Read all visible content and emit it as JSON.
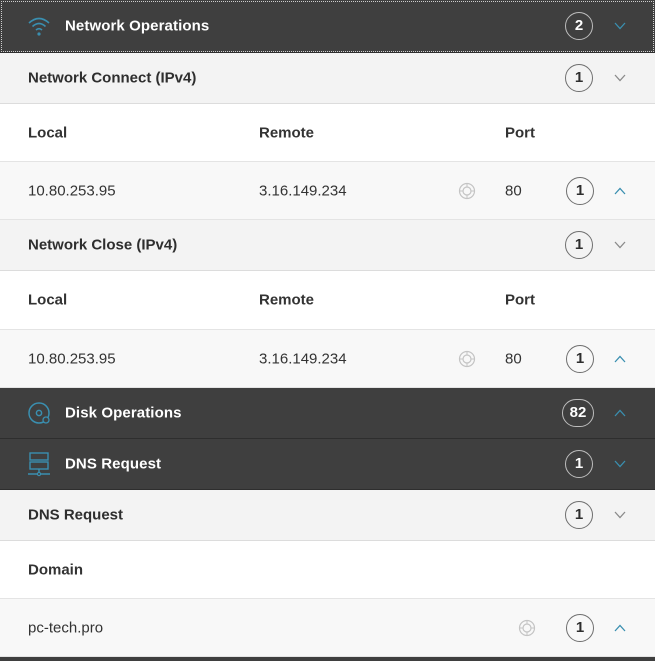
{
  "sections": {
    "network_operations": {
      "title": "Network Operations",
      "count": "2",
      "icon": "wifi-icon"
    },
    "network_connect": {
      "title": "Network Connect (IPv4)",
      "count": "1",
      "columns": {
        "local": "Local",
        "remote": "Remote",
        "port": "Port"
      },
      "rows": [
        {
          "local": "10.80.253.95",
          "remote": "3.16.149.234",
          "port": "80",
          "count": "1"
        }
      ]
    },
    "network_close": {
      "title": "Network Close (IPv4)",
      "count": "1",
      "columns": {
        "local": "Local",
        "remote": "Remote",
        "port": "Port"
      },
      "rows": [
        {
          "local": "10.80.253.95",
          "remote": "3.16.149.234",
          "port": "80",
          "count": "1"
        }
      ]
    },
    "disk_operations": {
      "title": "Disk Operations",
      "count": "82",
      "icon": "disk-icon"
    },
    "dns_request_category": {
      "title": "DNS Request",
      "count": "1",
      "icon": "server-icon"
    },
    "dns_request": {
      "title": "DNS Request",
      "count": "1",
      "columns": {
        "domain": "Domain"
      },
      "rows": [
        {
          "domain": "pc-tech.pro",
          "count": "1"
        }
      ]
    }
  },
  "colors": {
    "category_bg": "#3f3f3f",
    "subheader_bg": "#f3f3f3",
    "accent": "#3a8fb0"
  }
}
